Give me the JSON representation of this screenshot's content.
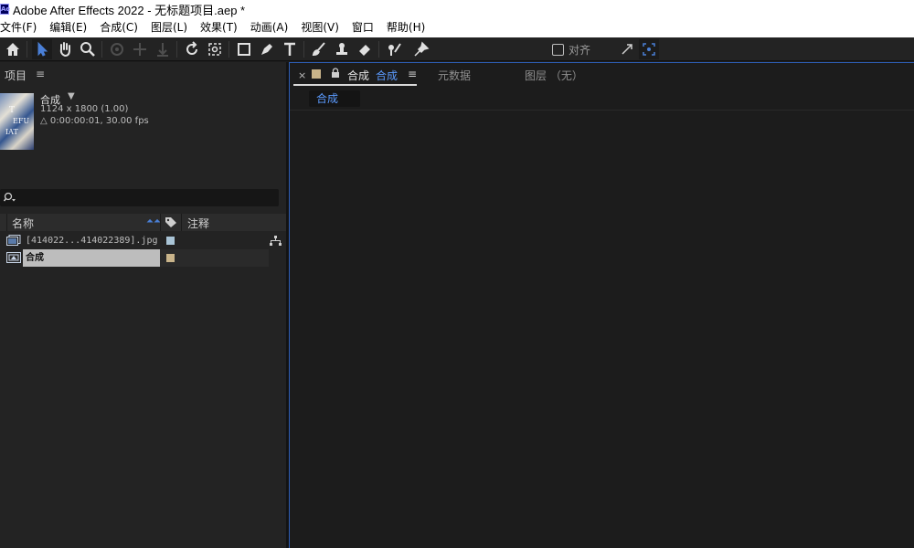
{
  "window": {
    "title": "Adobe After Effects 2022 - 无标题项目.aep *",
    "app_icon_text": "Ae"
  },
  "menu": [
    "文件(F)",
    "编辑(E)",
    "合成(C)",
    "图层(L)",
    "效果(T)",
    "动画(A)",
    "视图(V)",
    "窗口",
    "帮助(H)"
  ],
  "toolbar": {
    "snap_label": "对齐",
    "icons": [
      "home-icon",
      "selection-arrow-icon",
      "hand-icon",
      "zoom-icon",
      "orbit-icon",
      "pan-icon",
      "dolly-icon",
      "rotate-icon",
      "anchor-icon",
      "rectangle-icon",
      "pen-icon",
      "type-icon",
      "brush-icon",
      "clone-stamp-icon",
      "eraser-icon",
      "roto-brush-icon",
      "puppet-pin-icon",
      "expand-icon",
      "snap-target-icon"
    ]
  },
  "project": {
    "panel_title": "项目",
    "panel_menu": "≡",
    "selected_info": {
      "name": "合成",
      "dropdown": "▼",
      "dimensions": "1124 x 1800 (1.00)",
      "duration": "△ 0:00:00:01, 30.00 fps"
    },
    "search_placeholder": "",
    "columns": {
      "name": "名称",
      "comment": "注释"
    },
    "items": [
      {
        "label": "[414022...414022389].jpg",
        "type": "footage",
        "color": "#a9c4d6",
        "selected": false
      },
      {
        "label": "合成",
        "type": "composition",
        "color": "#c9b48a",
        "selected": true
      }
    ]
  },
  "composition_panel": {
    "close": "×",
    "tab_label": "合成",
    "tab_comp_name": "合成",
    "tab_menu": "≡",
    "metadata_tab": "元数据",
    "layer_tab": "图层 （无）",
    "breadcrumb": "合成"
  },
  "colors": {
    "accent_blue": "#5b9bff",
    "panel_bg": "#232323",
    "viewer_bg": "#1c1c1c",
    "focus_border": "#2d5db5"
  }
}
